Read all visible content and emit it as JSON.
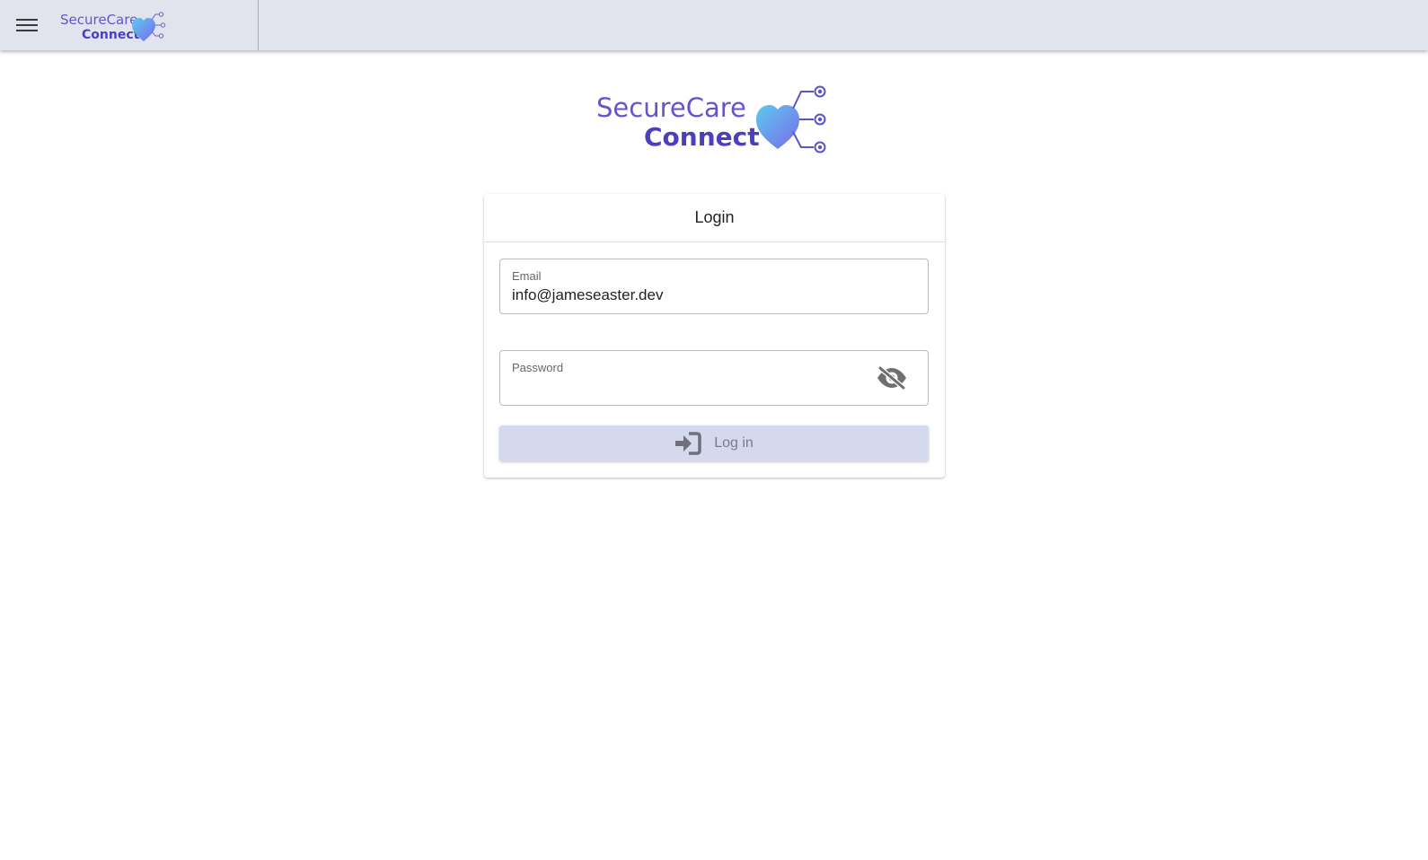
{
  "brand": {
    "name_line1": "SecureCare",
    "name_line2": "Connect",
    "colors": {
      "text_primary": "#6555cc",
      "text_secondary": "#4b3fc0",
      "heart_start": "#5ec8f0",
      "heart_end": "#7a6be8"
    }
  },
  "appbar": {
    "menu_icon": "hamburger-menu-icon",
    "background": "#e1e4ec"
  },
  "login_card": {
    "title": "Login",
    "email": {
      "label": "Email",
      "value": "info@jameseaster.dev"
    },
    "password": {
      "label": "Password",
      "value": "",
      "toggle_icon": "eye-off-icon"
    },
    "submit": {
      "label": "Log in",
      "icon": "login-arrow-icon",
      "background": "#d4d9ee"
    }
  }
}
